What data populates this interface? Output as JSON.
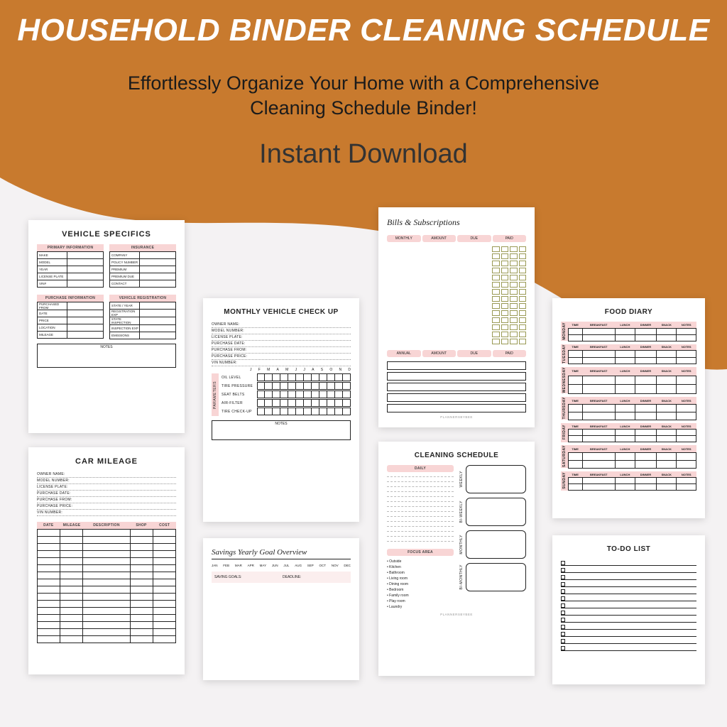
{
  "hero": {
    "headline": "HOUSEHOLD BINDER CLEANING SCHEDULE",
    "subhead_1": "Effortlessly Organize Your Home with a Comprehensive",
    "subhead_2": "Cleaning Schedule Binder!",
    "cta": "Instant Download",
    "bg_color": "#c87a2e"
  },
  "sheets": {
    "vehicle_specifics": {
      "title": "VEHICLE SPECIFICS",
      "sec1": "PRIMARY INFORMATION",
      "sec2": "INSURANCE",
      "sec3": "PURCHASE INFORMATION",
      "sec4": "VEHICLE REGISTRATION",
      "f1": [
        "MAKE",
        "MODEL",
        "YEAR",
        "LICENSE PLATE",
        "VIN#"
      ],
      "f2": [
        "COMPANY",
        "POLICY NUMBER",
        "PREMIUM",
        "PREMIUM DUE",
        "CONTACT"
      ],
      "f3": [
        "PURCHASED FROM",
        "DATE",
        "PRICE",
        "LOCATION",
        "MILEAGE"
      ],
      "f4": [
        "STATE / YEAR",
        "REGISTRATION EXP",
        "STATE INSPECTION",
        "INSPECTION EXP",
        "EMISSIONS"
      ],
      "notes": "NOTES"
    },
    "car_mileage": {
      "title": "CAR MILEAGE",
      "fields": [
        "OWNER NAME:",
        "MODEL NUMBER:",
        "LICENSE PLATE:",
        "PURCHASE DATE:",
        "PURCHASE FROM:",
        "PURCHASE PRICE:",
        "VIN NUMBER:"
      ],
      "cols": [
        "DATE",
        "MILEAGE",
        "DESCRIPTION",
        "SHOP",
        "COST"
      ]
    },
    "monthly_vehicle": {
      "title": "MONTHLY VEHICLE CHECK UP",
      "fields": [
        "OWNER NAME:",
        "MODEL NUMBER:",
        "LICENSE PLATE:",
        "PURCHASE DATE:",
        "PURCHASE FROM:",
        "PURCHASE PRICE:",
        "VIN NUMBER:"
      ],
      "months": [
        "J",
        "F",
        "M",
        "A",
        "M",
        "J",
        "J",
        "A",
        "S",
        "O",
        "N",
        "D"
      ],
      "params_label": "PARAMETERS",
      "params": [
        "OIL LEVEL",
        "TIRE PRESSURE",
        "SEAT BELTS",
        "AIR-FILTER",
        "TIRE CHECK-UP"
      ],
      "notes": "NOTES"
    },
    "savings": {
      "title": "Savings Yearly Goal Overview",
      "months": [
        "JAN",
        "FEB",
        "MAR",
        "APR",
        "MAY",
        "JUN",
        "JUL",
        "AUG",
        "SEP",
        "OCT",
        "NOV",
        "DEC"
      ],
      "l1": "SAVING GOALS:",
      "l2": "DEADLINE:"
    },
    "bills": {
      "title": "Bills & Subscriptions",
      "cols1": [
        "MONTHLY",
        "AMOUNT",
        "DUE",
        "PAID"
      ],
      "cols2": [
        "ANNUAL",
        "AMOUNT",
        "DUE",
        "PAID"
      ]
    },
    "cleaning": {
      "title": "CLEANING SCHEDULE",
      "daily": "DAILY",
      "periods": [
        "WEEKLY",
        "BI-WEEKLY",
        "MONTHLY",
        "BI-MONTHLY"
      ],
      "focus_title": "FOCUS AREA",
      "focus": [
        "Outside",
        "Kitchen",
        "Bathroom",
        "Living room",
        "Dining room",
        "Bedroom",
        "Family room",
        "Play room",
        "Laundry"
      ]
    },
    "food_diary": {
      "title": "FOOD DIARY",
      "cols": [
        "TIME",
        "BREAKFAST",
        "LUNCH",
        "DINNER",
        "SNACK",
        "NOTES"
      ],
      "days": [
        "MONDAY",
        "TUESDAY",
        "WEDNESDAY",
        "THURSDAY",
        "FRIDAY",
        "SATURDAY",
        "SUNDAY"
      ]
    },
    "todo": {
      "title": "TO-DO LIST"
    }
  }
}
